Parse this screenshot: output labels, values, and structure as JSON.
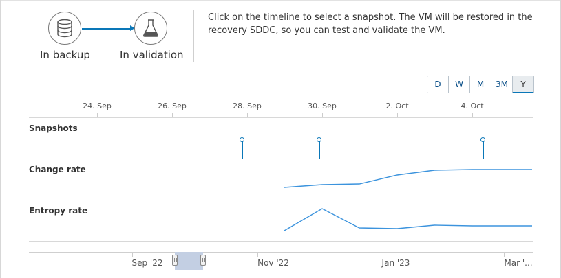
{
  "workflow": {
    "step1": {
      "label": "In backup",
      "icon": "database-icon"
    },
    "step2": {
      "label": "In validation",
      "icon": "flask-icon"
    },
    "description": "Click on the timeline to select a snapshot. The VM will be restored in the recovery SDDC, so you can test and validate the VM."
  },
  "range_buttons": [
    {
      "label": "D",
      "active": false
    },
    {
      "label": "W",
      "active": false
    },
    {
      "label": "M",
      "active": false
    },
    {
      "label": "3M",
      "active": false
    },
    {
      "label": "Y",
      "active": true
    }
  ],
  "timeline": {
    "ticks": [
      "24. Sep",
      "26. Sep",
      "28. Sep",
      "30. Sep",
      "2. Oct",
      "4. Oct"
    ],
    "rows": {
      "snapshots": "Snapshots",
      "change_rate": "Change rate",
      "entropy_rate": "Entropy rate"
    },
    "snapshot_count": 3
  },
  "navigator": {
    "labels": [
      "Sep '22",
      "Nov '22",
      "Jan '23",
      "Mar '..."
    ]
  },
  "colors": {
    "accent": "#0a77b8",
    "series": "#3b93dd",
    "window": "#c3cfe3"
  }
}
